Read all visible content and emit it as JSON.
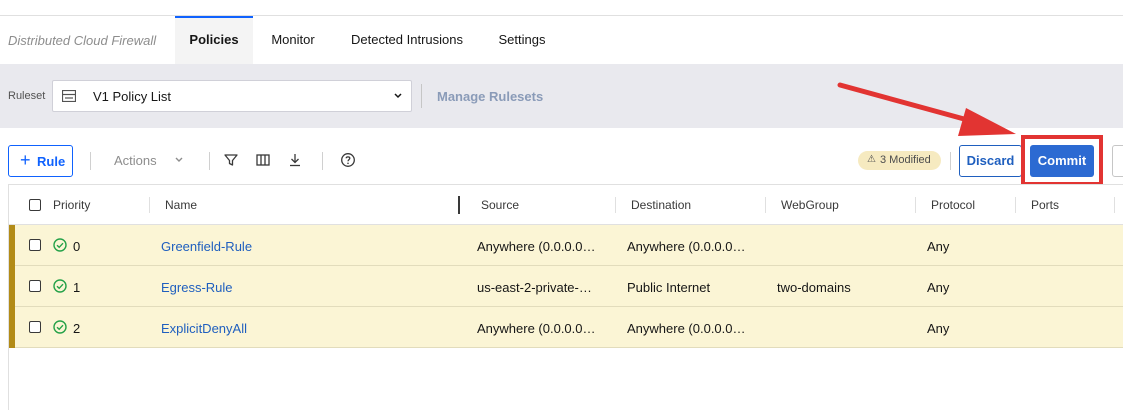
{
  "app": {
    "title": "Distributed Cloud Firewall"
  },
  "tabs": [
    {
      "label": "Policies",
      "active": true
    },
    {
      "label": "Monitor",
      "active": false
    },
    {
      "label": "Detected Intrusions",
      "active": false
    },
    {
      "label": "Settings",
      "active": false
    }
  ],
  "ruleset": {
    "label": "Ruleset",
    "selected": "V1 Policy List",
    "manage_link": "Manage Rulesets"
  },
  "toolbar": {
    "add_rule_label": "Rule",
    "actions_label": "Actions",
    "modified_badge": "3 Modified",
    "discard_label": "Discard",
    "commit_label": "Commit"
  },
  "table": {
    "headers": {
      "priority": "Priority",
      "name": "Name",
      "source": "Source",
      "destination": "Destination",
      "webgroup": "WebGroup",
      "protocol": "Protocol",
      "ports": "Ports"
    },
    "rows": [
      {
        "priority": "0",
        "name": "Greenfield-Rule",
        "source": "Anywhere (0.0.0.0…",
        "destination": "Anywhere (0.0.0.0…",
        "webgroup": "",
        "protocol": "Any",
        "ports": ""
      },
      {
        "priority": "1",
        "name": "Egress-Rule",
        "source": "us-east-2-private-…",
        "destination": "Public Internet",
        "webgroup": "two-domains",
        "protocol": "Any",
        "ports": ""
      },
      {
        "priority": "2",
        "name": "ExplicitDenyAll",
        "source": "Anywhere (0.0.0.0…",
        "destination": "Anywhere (0.0.0.0…",
        "webgroup": "",
        "protocol": "Any",
        "ports": ""
      }
    ]
  },
  "colors": {
    "primary": "#2c6ad2",
    "link": "#1f5fbf",
    "modified_row": "#fbf5d5",
    "modified_accent": "#b28b17",
    "annotation_red": "#e23432",
    "status_ok": "#24a148"
  },
  "icons": {
    "toolbar": [
      "filter-icon",
      "columns-icon",
      "download-icon",
      "help-icon"
    ],
    "row_status": "check-circle-icon"
  }
}
